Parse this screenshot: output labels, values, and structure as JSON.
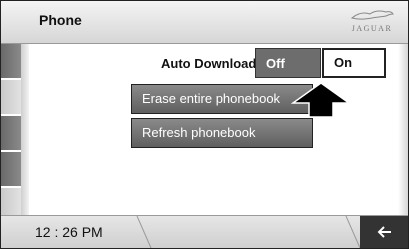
{
  "header": {
    "title": "Phone",
    "brand": "JAGUAR"
  },
  "auto_download": {
    "label": "Auto Download",
    "off_label": "Off",
    "on_label": "On",
    "selected": "On"
  },
  "actions": {
    "erase_label": "Erase entire phonebook",
    "refresh_label": "Refresh phonebook"
  },
  "footer": {
    "time": "12 : 26 PM"
  },
  "icons": {
    "back": "back-arrow-icon",
    "pointer": "pointer-arrow-icon",
    "logo": "jaguar-leaper-icon"
  },
  "colors": {
    "button_dark": "#5f5f5f",
    "selected_border": "#222222",
    "header": "#e0e0e0"
  }
}
